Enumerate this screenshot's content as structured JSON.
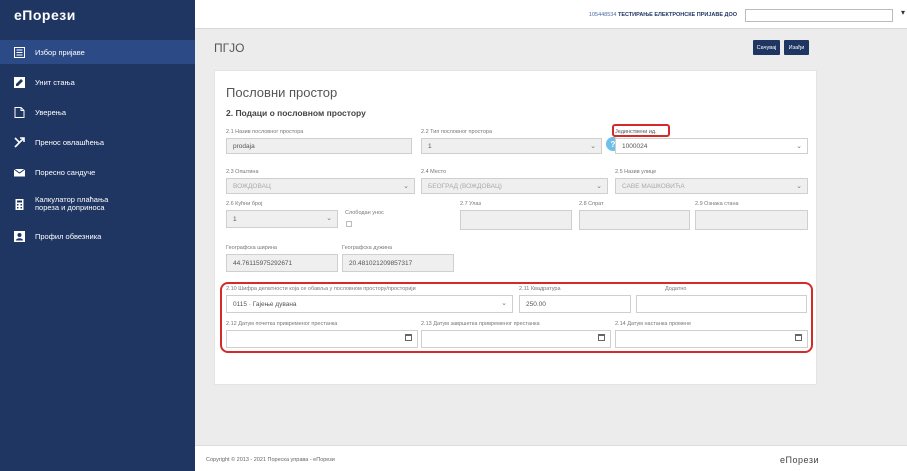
{
  "app": {
    "brand": "еПорези"
  },
  "sidebar": {
    "items": [
      {
        "label": "Избор пријаве",
        "icon": "list-icon"
      },
      {
        "label": "Унит стања",
        "icon": "pencil-icon"
      },
      {
        "label": "Уверења",
        "icon": "document-icon"
      },
      {
        "label": "Пренос овлашћења",
        "icon": "transfer-icon"
      },
      {
        "label": "Поресно сандуче",
        "icon": "mail-icon"
      },
      {
        "label": "Калкулатор плаћања пореза и доприноса",
        "icon": "calculator-icon"
      },
      {
        "label": "Профил обвезника",
        "icon": "user-card-icon"
      }
    ]
  },
  "topbar": {
    "user_id": "105448534",
    "user_name": "ТЕСТИРАЊЕ ЕЛЕКТРОНСКЕ ПРИЈАВЕ ДОО"
  },
  "header": {
    "title": "ПГЈО",
    "save_label": "Сачувај",
    "exit_label": "Изађи"
  },
  "form": {
    "card_title": "Пословни простор",
    "section_title": "2. Подаци о пословном простору",
    "f21_label": "2.1 Назив пословног простора",
    "f21_value": "prodaja",
    "f22_label": "2.2 Тип пословног простора",
    "f22_value": "1",
    "help_label": "?",
    "uid_label": "Јединствени ид.",
    "uid_value": "1000024",
    "f23_label": "2.3 Општина",
    "f23_value": "ВОЖДОВАЦ",
    "f24_label": "2.4 Место",
    "f24_value": "БЕОГРАД (ВОЖДОВАЦ)",
    "f25_label": "2.5 Назив улице",
    "f25_value": "САВЕ МАШКОВИЋА",
    "f26_label": "2.6 Кућни број",
    "f26_value": "1",
    "free_entry_label": "Слободан унос",
    "f27_label": "2.7 Улаз",
    "f28_label": "2.8 Спрат",
    "f29_label": "2.9 Ознака стана",
    "lat_label": "Географска ширина",
    "lat_value": "44.76115975292671",
    "lng_label": "Географска дужина",
    "lng_value": "20.481021209857317",
    "f210_label": "2.10 Шифра делатности која се обавља у пословном простору/просторији",
    "f210_value": "0115 · Гајење дувана",
    "f211_label": "2.11 Квадратура",
    "f211_value": "250.00",
    "extra_label": "Додатно",
    "f212_label": "2.12 Датум почетка привременог престанка",
    "f213_label": "2.13 Датум завршетка привременог престанка",
    "f214_label": "2.14 Датум настанка промене"
  },
  "footer": {
    "copyright": "Copyright © 2013 - 2021 Пореска управа - еПорези",
    "brand": "еПорези"
  },
  "colors": {
    "sidebar": "#1f3562",
    "accent_button": "#1f3562",
    "highlight": "#d42a2a",
    "help": "#6ec0ea"
  }
}
